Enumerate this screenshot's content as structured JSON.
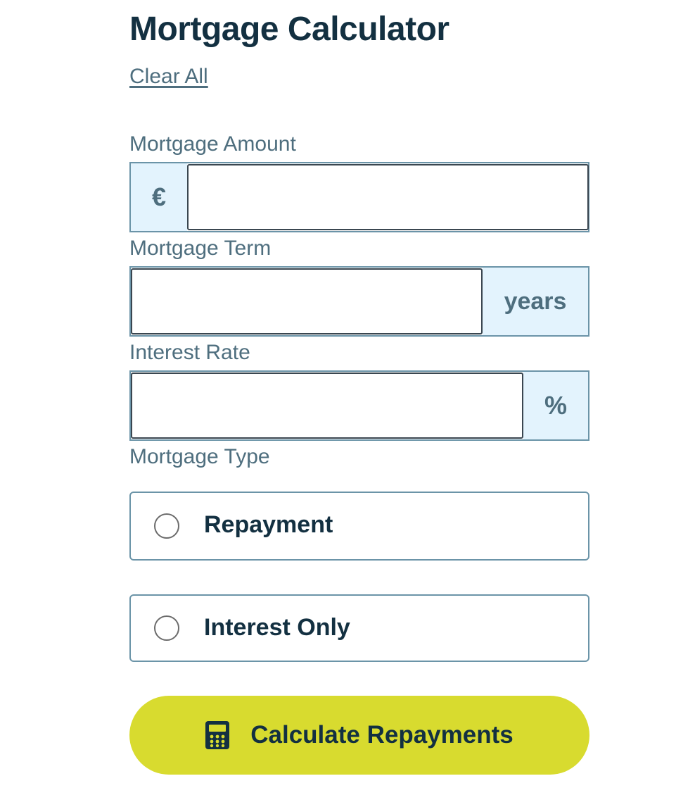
{
  "header": {
    "title": "Mortgage Calculator",
    "clear_label": "Clear All"
  },
  "amount": {
    "label": "Mortgage Amount",
    "prefix": "€",
    "value": ""
  },
  "term": {
    "label": "Mortgage Term",
    "suffix": "years",
    "value": ""
  },
  "rate": {
    "label": "Interest Rate",
    "suffix": "%",
    "value": ""
  },
  "type": {
    "label": "Mortgage Type",
    "options": [
      {
        "label": "Repayment",
        "selected": false
      },
      {
        "label": "Interest Only",
        "selected": false
      }
    ]
  },
  "action": {
    "label": "Calculate Repayments",
    "icon": "calculator-icon"
  },
  "colors": {
    "heading": "#133041",
    "label": "#4e6e7e",
    "border": "#6b94a8",
    "addon_bg": "#e3f3fd",
    "accent": "#d8db2f"
  }
}
